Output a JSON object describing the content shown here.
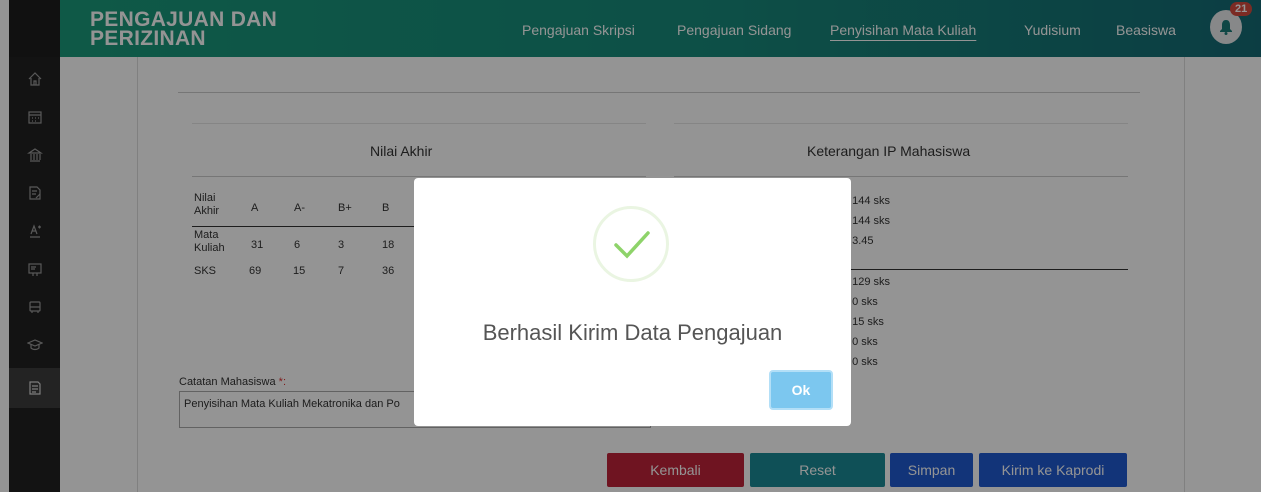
{
  "header": {
    "brand_line1": "PENGAJUAN DAN",
    "brand_line2": "PERIZINAN",
    "nav": [
      "Pengajuan Skripsi",
      "Pengajuan Sidang",
      "Penyisihan Mata Kuliah",
      "Yudisium",
      "Beasiswa"
    ],
    "active_nav": "Penyisihan Mata Kuliah",
    "notification_count": "21"
  },
  "sidebar": {
    "icons": [
      "home-icon",
      "calendar-icon",
      "bank-icon",
      "document-edit-icon",
      "grade-icon",
      "certificate-icon",
      "bus-icon",
      "graduation-cap-icon",
      "document-list-icon"
    ],
    "active_index": 8
  },
  "nilai_akhir": {
    "title": "Nilai Akhir",
    "headers": [
      "Nilai Akhir",
      "A",
      "A-",
      "B+",
      "B"
    ],
    "rows": [
      [
        "Mata Kuliah",
        "31",
        "6",
        "3",
        "18"
      ],
      [
        "SKS",
        "69",
        "15",
        "7",
        "36"
      ]
    ]
  },
  "keterangan": {
    "title": "Keterangan IP Mahasiswa",
    "values_top": [
      ": 144 sks",
      ": 144 sks",
      ": 3.45"
    ],
    "values_bottom": [
      ": 129 sks",
      ": 0 sks",
      ": 15 sks",
      ": 0 sks",
      ": 0 sks"
    ]
  },
  "catatan": {
    "label": "Catatan Mahasiswa ",
    "required": "*:",
    "value": "Penyisihan Mata Kuliah Mekatronika dan Po"
  },
  "buttons": {
    "kembali": "Kembali",
    "reset": "Reset",
    "simpan": "Simpan",
    "kirim": "Kirim ke Kaprodi"
  },
  "colors": {
    "kembali": "#c0243a",
    "reset": "#1a8a96",
    "simpan": "#1f5bd0",
    "kirim": "#1f5bd0",
    "check": "#8ed36a"
  },
  "modal": {
    "title": "Berhasil Kirim Data Pengajuan",
    "ok_label": "Ok"
  }
}
